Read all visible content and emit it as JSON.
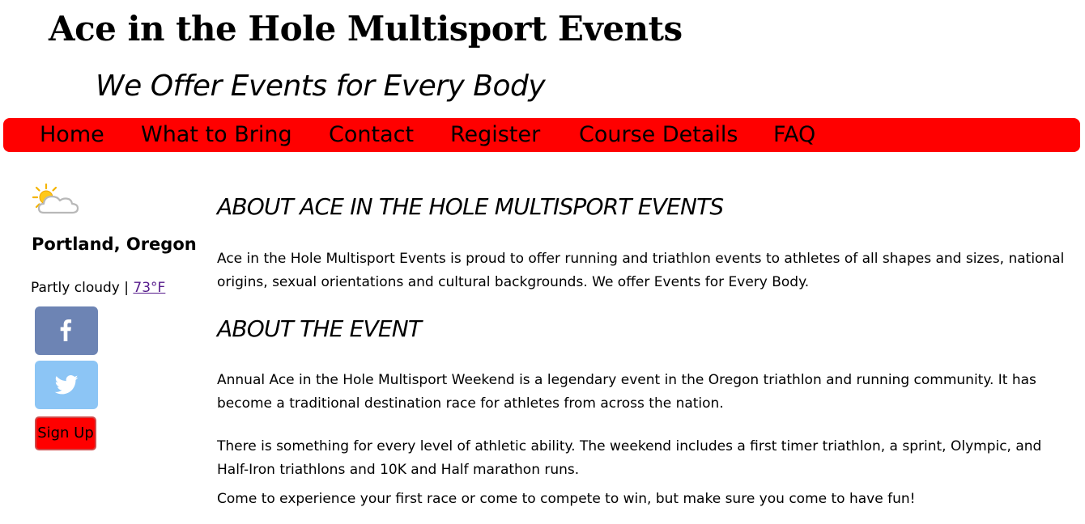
{
  "header": {
    "title": "Ace in the Hole Multisport Events",
    "tagline": "We Offer Events for Every Body"
  },
  "nav": {
    "items": [
      "Home",
      "What to Bring",
      "Contact",
      "Register",
      "Course Details",
      "FAQ"
    ]
  },
  "sidebar": {
    "weather_icon": "partly-cloudy-icon",
    "city": "Portland, Oregon",
    "condition": "Partly cloudy",
    "separator": "|",
    "temperature": "73°F",
    "social": [
      {
        "name": "facebook",
        "icon": "facebook-icon",
        "color": "#6d84b4"
      },
      {
        "name": "twitter",
        "icon": "twitter-icon",
        "color": "#8cc5f5"
      }
    ],
    "signup_label": "Sign Up"
  },
  "main": {
    "about_heading": "ABOUT ACE IN THE HOLE MULTISPORT EVENTS",
    "about_text": "Ace in the Hole Multisport Events is proud to offer running and triathlon events to athletes of all shapes and sizes, national origins, sexual orientations and cultural backgrounds. We offer Events for Every Body.",
    "event_heading": "ABOUT THE EVENT",
    "event_paragraphs": [
      "Annual Ace in the Hole Multisport Weekend is a legendary event in the Oregon triathlon and running community. It has become a traditional destination race for athletes from across the nation.",
      "There is something for every level of athletic ability. The weekend includes a first timer triathlon, a sprint, Olympic, and Half-Iron triathlons and 10K and Half marathon runs.",
      "Come to experience your first race or come to compete to win, but make sure you come to have fun!"
    ]
  },
  "colors": {
    "nav_background": "#ff0000",
    "signup_background": "#ff0000",
    "link_visited": "#551a8b"
  }
}
